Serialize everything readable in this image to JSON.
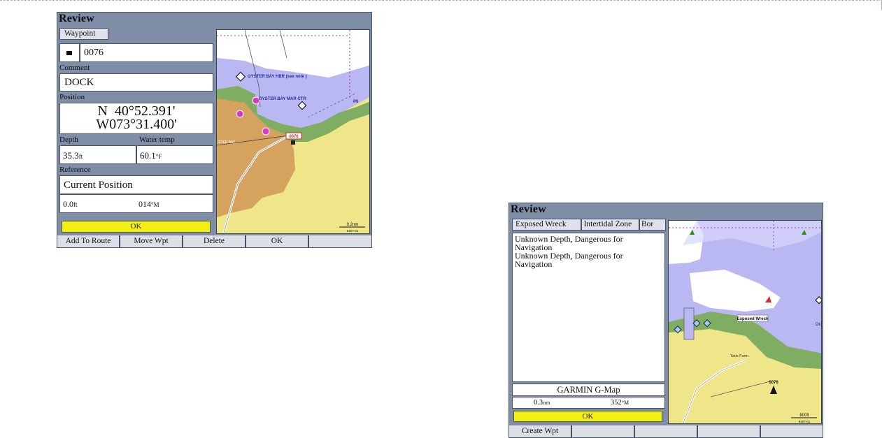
{
  "screen1": {
    "title": "Review",
    "tab": "Waypoint",
    "waypoint_name": "0076",
    "comment_label": "Comment",
    "comment": "DOCK",
    "position_label": "Position",
    "position_lat": "N  40°52.391'",
    "position_lon": "W073°31.400'",
    "depth_label": "Depth",
    "depth_value": "35.3",
    "depth_unit": "ft",
    "water_temp_label": "Water temp",
    "water_temp_value": "60.1",
    "water_temp_unit": "°F",
    "reference_label": "Reference",
    "reference_value": "Current Position",
    "distance_value": "0.0",
    "distance_unit": "ft",
    "bearing_value": "014",
    "bearing_unit": "°M",
    "ok_label": "OK",
    "softkeys": [
      "Add To Route",
      "Move Wpt",
      "Delete",
      "OK",
      ""
    ],
    "map": {
      "labels": {
        "oyster_bay_hbr": "OYSTER BAY HBR (see note )",
        "oyster_bay_mar": "OYSTER BAY MAR CTR",
        "p6": "P6",
        "wpt_0076": "0076",
        "oyster_bay": "STER BAY",
        "scale_value": "0.2nm",
        "scale_id": "9407-01"
      }
    }
  },
  "screen2": {
    "title": "Review",
    "tabs": [
      "Exposed Wreck",
      "Intertidal Zone",
      "Bor"
    ],
    "info_text": [
      "Unknown Depth, Dangerous for Navigation",
      "Unknown Depth, Dangerous for Navigation"
    ],
    "source": "GARMIN G-Map",
    "distance_value": "0.3",
    "distance_unit": "nm",
    "bearing_value": "352",
    "bearing_unit": "°M",
    "ok_label": "OK",
    "softkeys": [
      "Create Wpt",
      "",
      "",
      "",
      ""
    ],
    "map": {
      "labels": {
        "exposed_wreck": "Exposed Wreck",
        "wpt_0076": "0076",
        "tank_farm": "Tank Farm",
        "dk": "Dk",
        "scale_value": "800ft",
        "scale_id": "9407-01"
      }
    }
  },
  "colors": {
    "frame": "#7e8ea6",
    "ok_yellow": "#f3ef12",
    "land": "#efe68a",
    "water": "#b9b8f2",
    "deep_water": "#ffffff",
    "shore_green": "#7fae63",
    "built_up": "#d6a35f"
  }
}
